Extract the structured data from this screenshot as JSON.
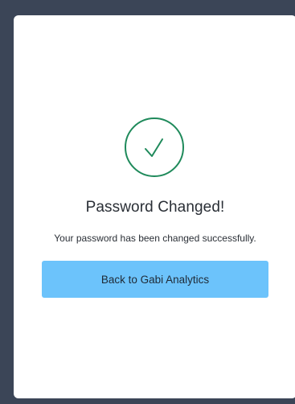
{
  "status": {
    "icon": "check-circle-icon",
    "color": "#1f8a5b"
  },
  "content": {
    "title": "Password Changed!",
    "message": "Your password has been changed successfully."
  },
  "actions": {
    "back_label": "Back to Gabi Analytics",
    "button_color": "#6cc3fb"
  },
  "colors": {
    "backdrop": "#3b4557",
    "card": "#ffffff",
    "text": "#2a2f36"
  }
}
